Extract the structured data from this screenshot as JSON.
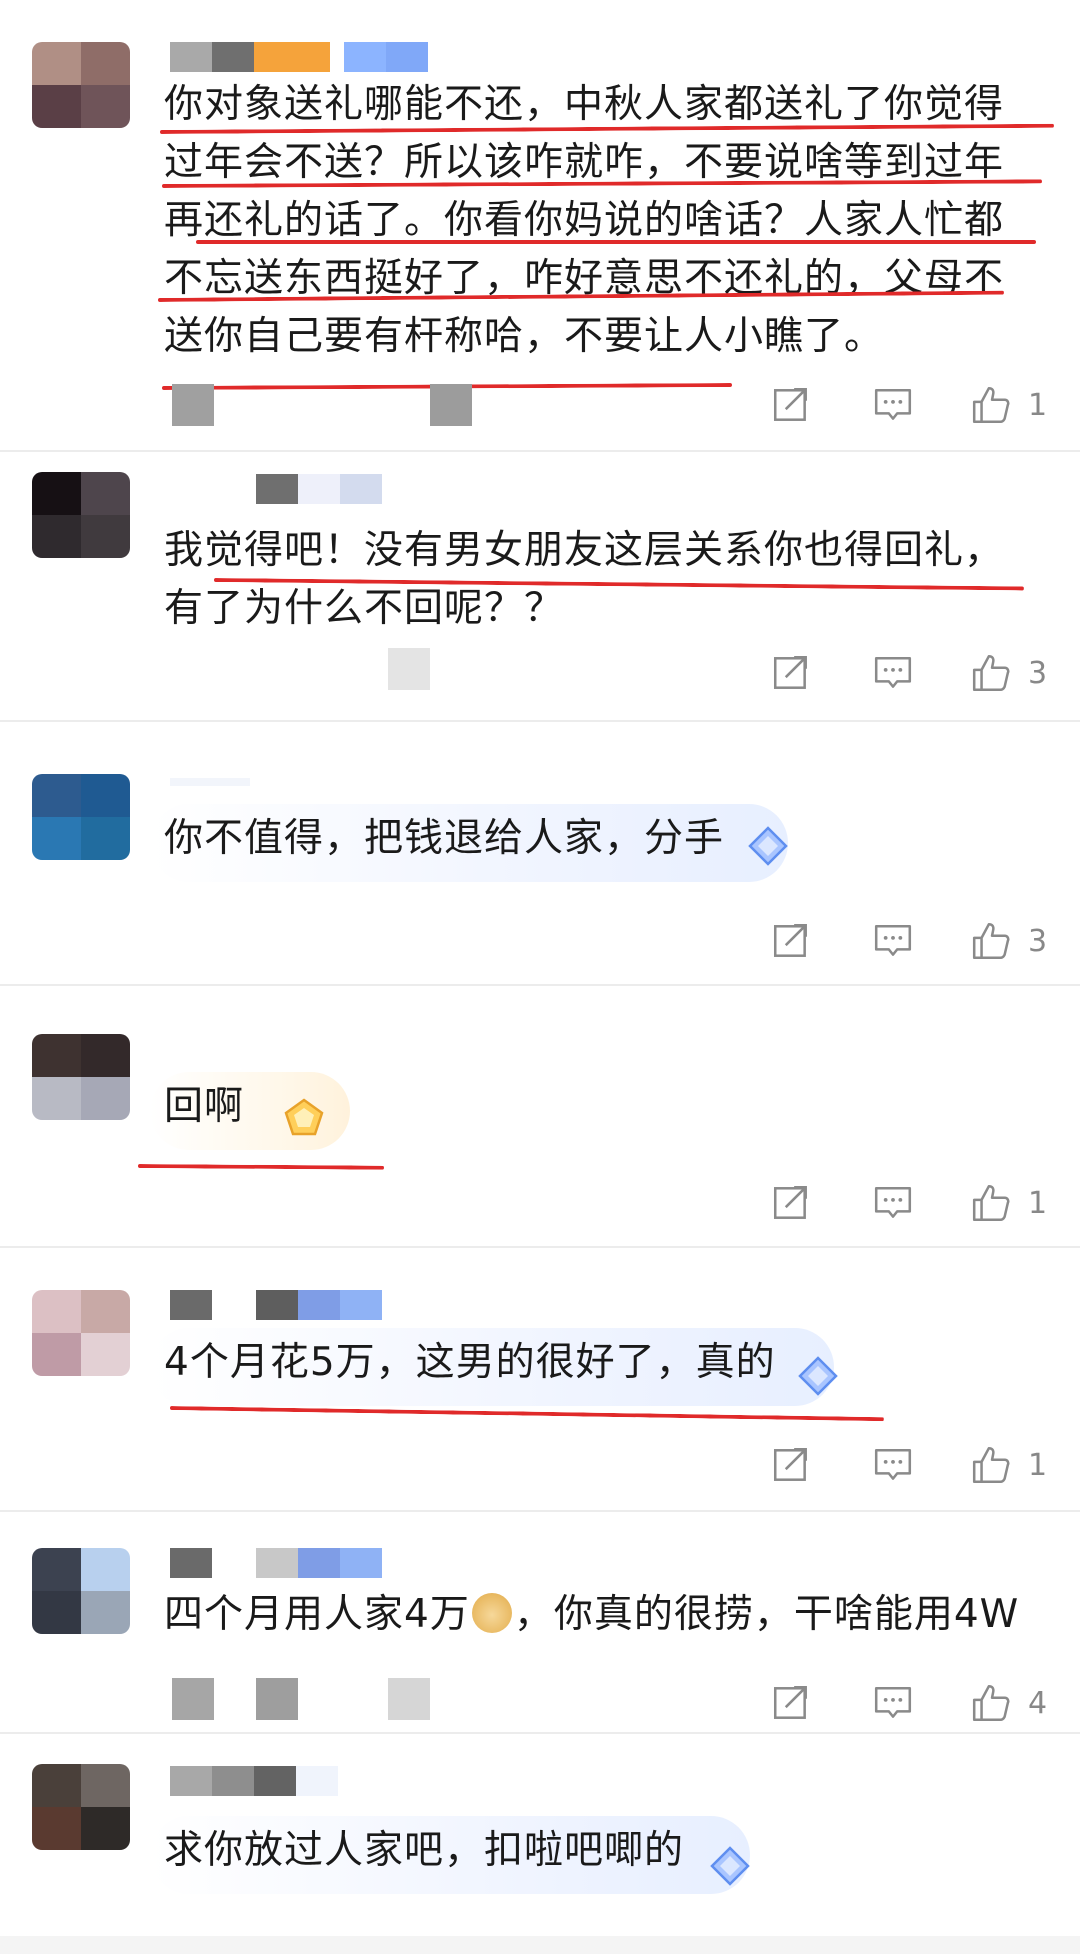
{
  "comments": [
    {
      "text": "你对象送礼哪能不还，中秋人家都送礼了你觉得过年会不送？所以该咋就咋，不要说啥等到过年再还礼的话了。你看你妈说的啥话？人家人忙都不忘送东西挺好了，咋好意思不还礼的，父母不送你自己要有杆称哈，不要让人小瞧了。",
      "likes": "1"
    },
    {
      "text": "我觉得吧！没有男女朋友这层关系你也得回礼，有了为什么不回呢？？",
      "likes": "3"
    },
    {
      "text": "你不值得，把钱退给人家，分手",
      "likes": "3"
    },
    {
      "text": "回啊",
      "likes": "1"
    },
    {
      "text": "4个月花5万，这男的很好了，真的",
      "likes": "1"
    },
    {
      "text_before": "四个月用人家4万",
      "emoji": "doge-emoji",
      "text_after": "，你真的很捞，干啥能用4W",
      "likes": "4"
    },
    {
      "text": "求你放过人家吧，扣啦吧唧的"
    }
  ],
  "colors": {
    "underline": "#e02a2a",
    "icon": "#8a8a8a",
    "divider": "#ececec"
  }
}
